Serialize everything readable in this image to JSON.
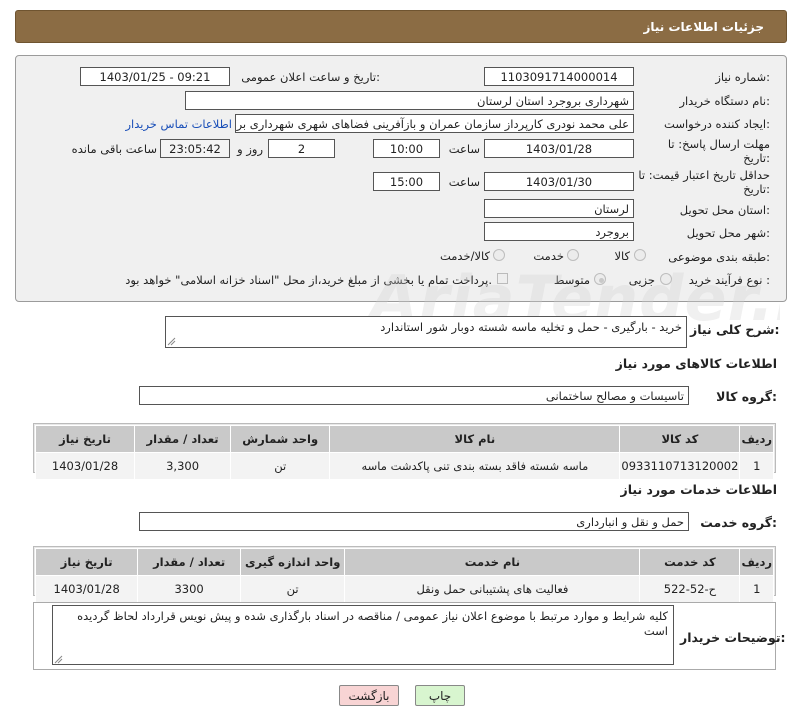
{
  "header": {
    "title": "جزئیات اطلاعات نیاز"
  },
  "form": {
    "need_number_label": "شماره نیاز:",
    "need_number": "1103091714000014",
    "announce_label": "تاریخ و ساعت اعلان عمومی:",
    "announce_value": "1403/01/25 - 09:21",
    "buyer_org_label": "نام دستگاه خریدار:",
    "buyer_org": "شهرداری بروجرد استان لرستان",
    "creator_label": "ایجاد کننده درخواست:",
    "creator": "علی محمد نودری کارپرداز سازمان عمران و بازآفرینی فضاهای شهری شهرداری بر",
    "contact_link": "اطلاعات تماس خریدار",
    "deadline_label": "مهلت ارسال پاسخ: تا تاریخ:",
    "deadline_date": "1403/01/28",
    "time_label": "ساعت",
    "deadline_time": "10:00",
    "days_value": "2",
    "days_label": "روز و",
    "remaining_time": "23:05:42",
    "remaining_label": "ساعت باقی مانده",
    "validity_label": "حداقل تاریخ اعتبار قیمت: تا تاریخ:",
    "validity_date": "1403/01/30",
    "validity_time_label": "ساعت",
    "validity_time": "15:00",
    "province_label": "استان محل تحویل:",
    "province": "لرستان",
    "city_label": "شهر محل تحویل:",
    "city": "بروجرد",
    "category_label": "طبقه بندی موضوعی:",
    "category_options": [
      "کالا",
      "خدمت",
      "کالا/خدمت"
    ],
    "process_label": "نوع فرآیند خرید :",
    "process_options": [
      "جزیی",
      "متوسط"
    ],
    "payment_note": "پرداخت تمام یا بخشی از مبلغ خرید،از محل \"اسناد خزانه اسلامی\" خواهد بود."
  },
  "watermark": "AriaTender.neT",
  "description": {
    "label": "شرح کلی نیاز:",
    "value": "خرید - بارگیری - حمل و تخلیه ماسه شسته دوبار شور استاندارد"
  },
  "goods": {
    "section_title": "اطلاعات کالاهای مورد نیاز",
    "group_label": "گروه کالا:",
    "group_value": "تاسیسات و مصالح ساختمانی",
    "columns": [
      "ردیف",
      "کد کالا",
      "نام کالا",
      "واحد شمارش",
      "تعداد / مقدار",
      "تاریخ نیاز"
    ],
    "rows": [
      [
        "1",
        "0933110713120002",
        "ماسه شسته فاقد بسته بندی تنی پاکدشت ماسه",
        "تن",
        "3,300",
        "1403/01/28"
      ]
    ]
  },
  "services": {
    "section_title": "اطلاعات خدمات مورد نیاز",
    "group_label": "گروه خدمت:",
    "group_value": "حمل و نقل و انبارداری",
    "columns": [
      "ردیف",
      "کد خدمت",
      "نام خدمت",
      "واحد اندازه گیری",
      "تعداد / مقدار",
      "تاریخ نیاز"
    ],
    "rows": [
      [
        "1",
        "ح-52-522",
        "فعالیت های پشتیبانی حمل ونقل",
        "تن",
        "3300",
        "1403/01/28"
      ]
    ]
  },
  "notes": {
    "label": "توضیحات خریدار:",
    "value": "کلیه شرایط و موارد مرتبط با موضوع اعلان نیاز عمومی / مناقصه در اسناد بارگذاری شده و پیش نویس قرارداد لحاظ گردیده است"
  },
  "buttons": {
    "print": "چاپ",
    "back": "بازگشت"
  }
}
